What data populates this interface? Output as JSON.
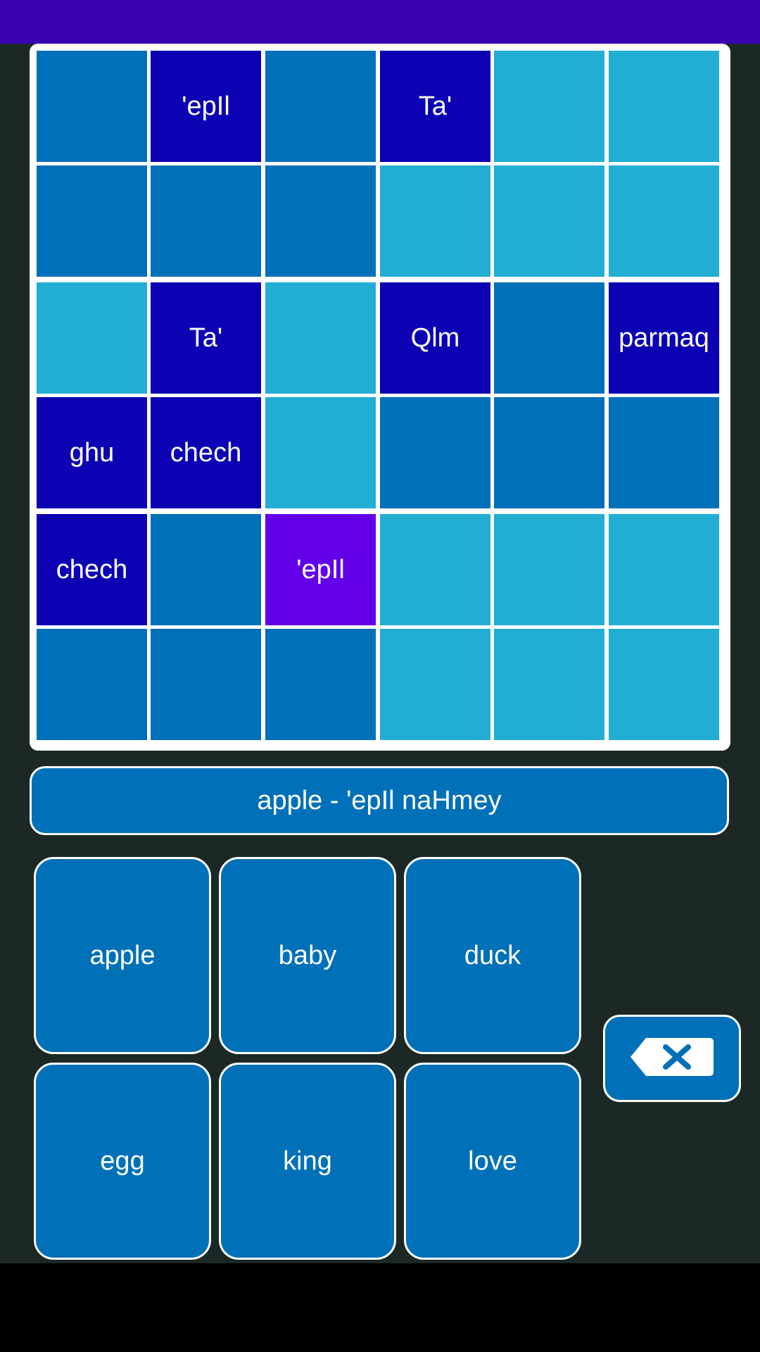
{
  "colors": {
    "status_bar": "#3a01b3",
    "background": "#1b2826",
    "tile_dark": "#0070b8",
    "tile_light": "#22aed3",
    "tile_word": "#0c02b3",
    "tile_selected": "#6200ea",
    "board_border": "#ffffff"
  },
  "grid": {
    "rows": [
      [
        {
          "text": "",
          "state": "dark"
        },
        {
          "text": "'epIl",
          "state": "word"
        },
        {
          "text": "",
          "state": "dark"
        },
        {
          "text": "Ta'",
          "state": "word"
        },
        {
          "text": "",
          "state": "light"
        },
        {
          "text": "",
          "state": "light"
        }
      ],
      [
        {
          "text": "",
          "state": "dark"
        },
        {
          "text": "",
          "state": "dark"
        },
        {
          "text": "",
          "state": "dark"
        },
        {
          "text": "",
          "state": "light"
        },
        {
          "text": "",
          "state": "light"
        },
        {
          "text": "",
          "state": "light"
        }
      ],
      [
        {
          "text": "",
          "state": "light"
        },
        {
          "text": "Ta'",
          "state": "word"
        },
        {
          "text": "",
          "state": "light"
        },
        {
          "text": "Qlm",
          "state": "word"
        },
        {
          "text": "",
          "state": "dark"
        },
        {
          "text": "parmaq",
          "state": "word"
        }
      ],
      [
        {
          "text": "ghu",
          "state": "word"
        },
        {
          "text": "chech",
          "state": "word"
        },
        {
          "text": "",
          "state": "light"
        },
        {
          "text": "",
          "state": "dark"
        },
        {
          "text": "",
          "state": "dark"
        },
        {
          "text": "",
          "state": "dark"
        }
      ],
      [
        {
          "text": "chech",
          "state": "word"
        },
        {
          "text": "",
          "state": "dark"
        },
        {
          "text": "'epIl",
          "state": "selected"
        },
        {
          "text": "",
          "state": "light"
        },
        {
          "text": "",
          "state": "light"
        },
        {
          "text": "",
          "state": "light"
        }
      ],
      [
        {
          "text": "",
          "state": "dark"
        },
        {
          "text": "",
          "state": "dark"
        },
        {
          "text": "",
          "state": "dark"
        },
        {
          "text": "",
          "state": "light"
        },
        {
          "text": "",
          "state": "light"
        },
        {
          "text": "",
          "state": "light"
        }
      ]
    ]
  },
  "word_display": {
    "text": "apple - 'epIl naHmey"
  },
  "keypad": {
    "keys": [
      "apple",
      "baby",
      "duck",
      "egg",
      "king",
      "love"
    ],
    "backspace_icon": "backspace-icon"
  }
}
